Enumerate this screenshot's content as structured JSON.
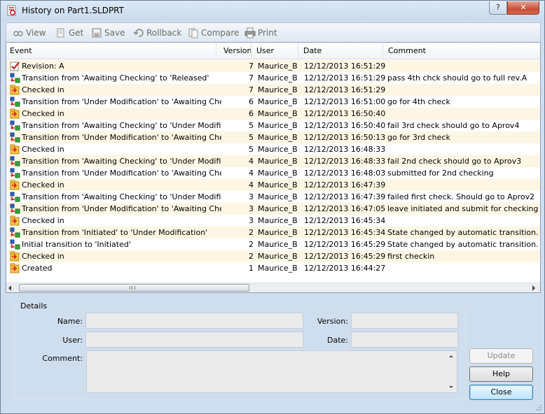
{
  "window": {
    "title": "History on Part1.SLDPRT",
    "help_glyph": "?",
    "close_glyph": "✕"
  },
  "toolbar": {
    "view": "View",
    "get": "Get",
    "save": "Save",
    "rollback": "Rollback",
    "compare": "Compare",
    "print": "Print"
  },
  "grid": {
    "columns": [
      "Event",
      "Version",
      "User",
      "Date",
      "Comment"
    ],
    "rows": [
      {
        "icon": "revision-check-icon",
        "event": "Revision: A",
        "version": "7",
        "user": "Maurice_B",
        "date": "12/12/2013 16:51:29",
        "comment": ""
      },
      {
        "icon": "transition-icon",
        "event": "Transition from 'Awaiting Checking' to 'Released'",
        "version": "7",
        "user": "Maurice_B",
        "date": "12/12/2013 16:51:29",
        "comment": "pass 4th chck should go to full rev.A"
      },
      {
        "icon": "checked-in-icon",
        "event": "Checked in",
        "version": "7",
        "user": "Maurice_B",
        "date": "12/12/2013 16:51:29",
        "comment": ""
      },
      {
        "icon": "transition-icon",
        "event": "Transition from 'Under Modification' to 'Awaiting Checking'",
        "version": "6",
        "user": "Maurice_B",
        "date": "12/12/2013 16:51:00",
        "comment": "go for 4th check"
      },
      {
        "icon": "checked-in-icon",
        "event": "Checked in",
        "version": "6",
        "user": "Maurice_B",
        "date": "12/12/2013 16:50:40",
        "comment": ""
      },
      {
        "icon": "transition-icon",
        "event": "Transition from 'Awaiting Checking' to 'Under Modification'",
        "version": "5",
        "user": "Maurice_B",
        "date": "12/12/2013 16:50:40",
        "comment": "fail 3rd check should go to Aprov4"
      },
      {
        "icon": "transition-icon",
        "event": "Transition from 'Under Modification' to 'Awaiting Checking'",
        "version": "5",
        "user": "Maurice_B",
        "date": "12/12/2013 16:50:13",
        "comment": "go for 3rd check"
      },
      {
        "icon": "checked-in-icon",
        "event": "Checked in",
        "version": "5",
        "user": "Maurice_B",
        "date": "12/12/2013 16:48:33",
        "comment": ""
      },
      {
        "icon": "transition-icon",
        "event": "Transition from 'Awaiting Checking' to 'Under Modification'",
        "version": "4",
        "user": "Maurice_B",
        "date": "12/12/2013 16:48:33",
        "comment": "fail 2nd check should go to Aprov3"
      },
      {
        "icon": "transition-icon",
        "event": "Transition from 'Under Modification' to 'Awaiting Checking'",
        "version": "4",
        "user": "Maurice_B",
        "date": "12/12/2013 16:48:03",
        "comment": "submitted for 2nd checking"
      },
      {
        "icon": "checked-in-icon",
        "event": "Checked in",
        "version": "4",
        "user": "Maurice_B",
        "date": "12/12/2013 16:47:39",
        "comment": ""
      },
      {
        "icon": "transition-icon",
        "event": "Transition from 'Awaiting Checking' to 'Under Modification'",
        "version": "3",
        "user": "Maurice_B",
        "date": "12/12/2013 16:47:39",
        "comment": "failed first check. Should go to Aprov2"
      },
      {
        "icon": "transition-icon",
        "event": "Transition from 'Under Modification' to 'Awaiting Checking'",
        "version": "3",
        "user": "Maurice_B",
        "date": "12/12/2013 16:47:05",
        "comment": "leave initiated and submit for checking"
      },
      {
        "icon": "checked-in-icon",
        "event": "Checked in",
        "version": "3",
        "user": "Maurice_B",
        "date": "12/12/2013 16:45:34",
        "comment": ""
      },
      {
        "icon": "transition-icon",
        "event": "Transition from 'Initiated' to 'Under Modification'",
        "version": "2",
        "user": "Maurice_B",
        "date": "12/12/2013 16:45:34",
        "comment": "State changed by automatic transition."
      },
      {
        "icon": "transition-icon",
        "event": "Initial transition to 'Initiated'",
        "version": "2",
        "user": "Maurice_B",
        "date": "12/12/2013 16:45:29",
        "comment": "State changed by automatic transition."
      },
      {
        "icon": "checked-in-icon",
        "event": "Checked in",
        "version": "2",
        "user": "Maurice_B",
        "date": "12/12/2013 16:45:29",
        "comment": "first checkin"
      },
      {
        "icon": "created-icon",
        "event": "Created",
        "version": "1",
        "user": "Maurice_B",
        "date": "12/12/2013 16:44:27",
        "comment": ""
      }
    ]
  },
  "details": {
    "legend": "Details",
    "name_label": "Name:",
    "name_value": "",
    "version_label": "Version:",
    "version_value": "",
    "user_label": "User:",
    "user_value": "",
    "date_label": "Date:",
    "date_value": "",
    "comment_label": "Comment:",
    "comment_value": ""
  },
  "buttons": {
    "update": "Update",
    "help": "Help",
    "close": "Close"
  },
  "colors": {
    "odd_row": "#fdf6e3",
    "window_bg": "#cfdeee"
  }
}
